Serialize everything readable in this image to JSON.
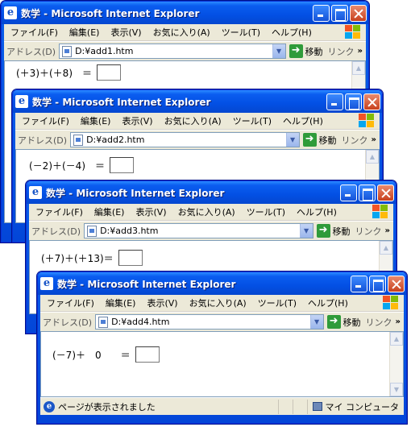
{
  "windows": [
    {
      "title": "数学 - Microsoft Internet Explorer",
      "address": "D:¥add1.htm",
      "expression": "(＋3)＋(＋8)　＝"
    },
    {
      "title": "数学 - Microsoft Internet Explorer",
      "address": "D:¥add2.htm",
      "expression": "(－2)＋(－4)　＝"
    },
    {
      "title": "数学 - Microsoft Internet Explorer",
      "address": "D:¥add3.htm",
      "expression": "(＋7)＋(＋13)＝"
    },
    {
      "title": "数学 - Microsoft Internet Explorer",
      "address": "D:¥add4.htm",
      "expression": "(－7)＋　0　　＝"
    }
  ],
  "menu": {
    "file": "ファイル(F)",
    "edit": "編集(E)",
    "view": "表示(V)",
    "favorites": "お気に入り(A)",
    "tools": "ツール(T)",
    "help": "ヘルプ(H)"
  },
  "addressbar": {
    "label": "アドレス(D)",
    "go": "移動",
    "links": "リンク",
    "chevron": "»"
  },
  "status": {
    "text": "ページが表示されました",
    "zone": "マイ コンピュータ"
  },
  "icons": {
    "ie": "internet-explorer-icon",
    "go": "green-arrow-icon",
    "windows": "windows-flag-icon",
    "computer": "my-computer-icon"
  }
}
